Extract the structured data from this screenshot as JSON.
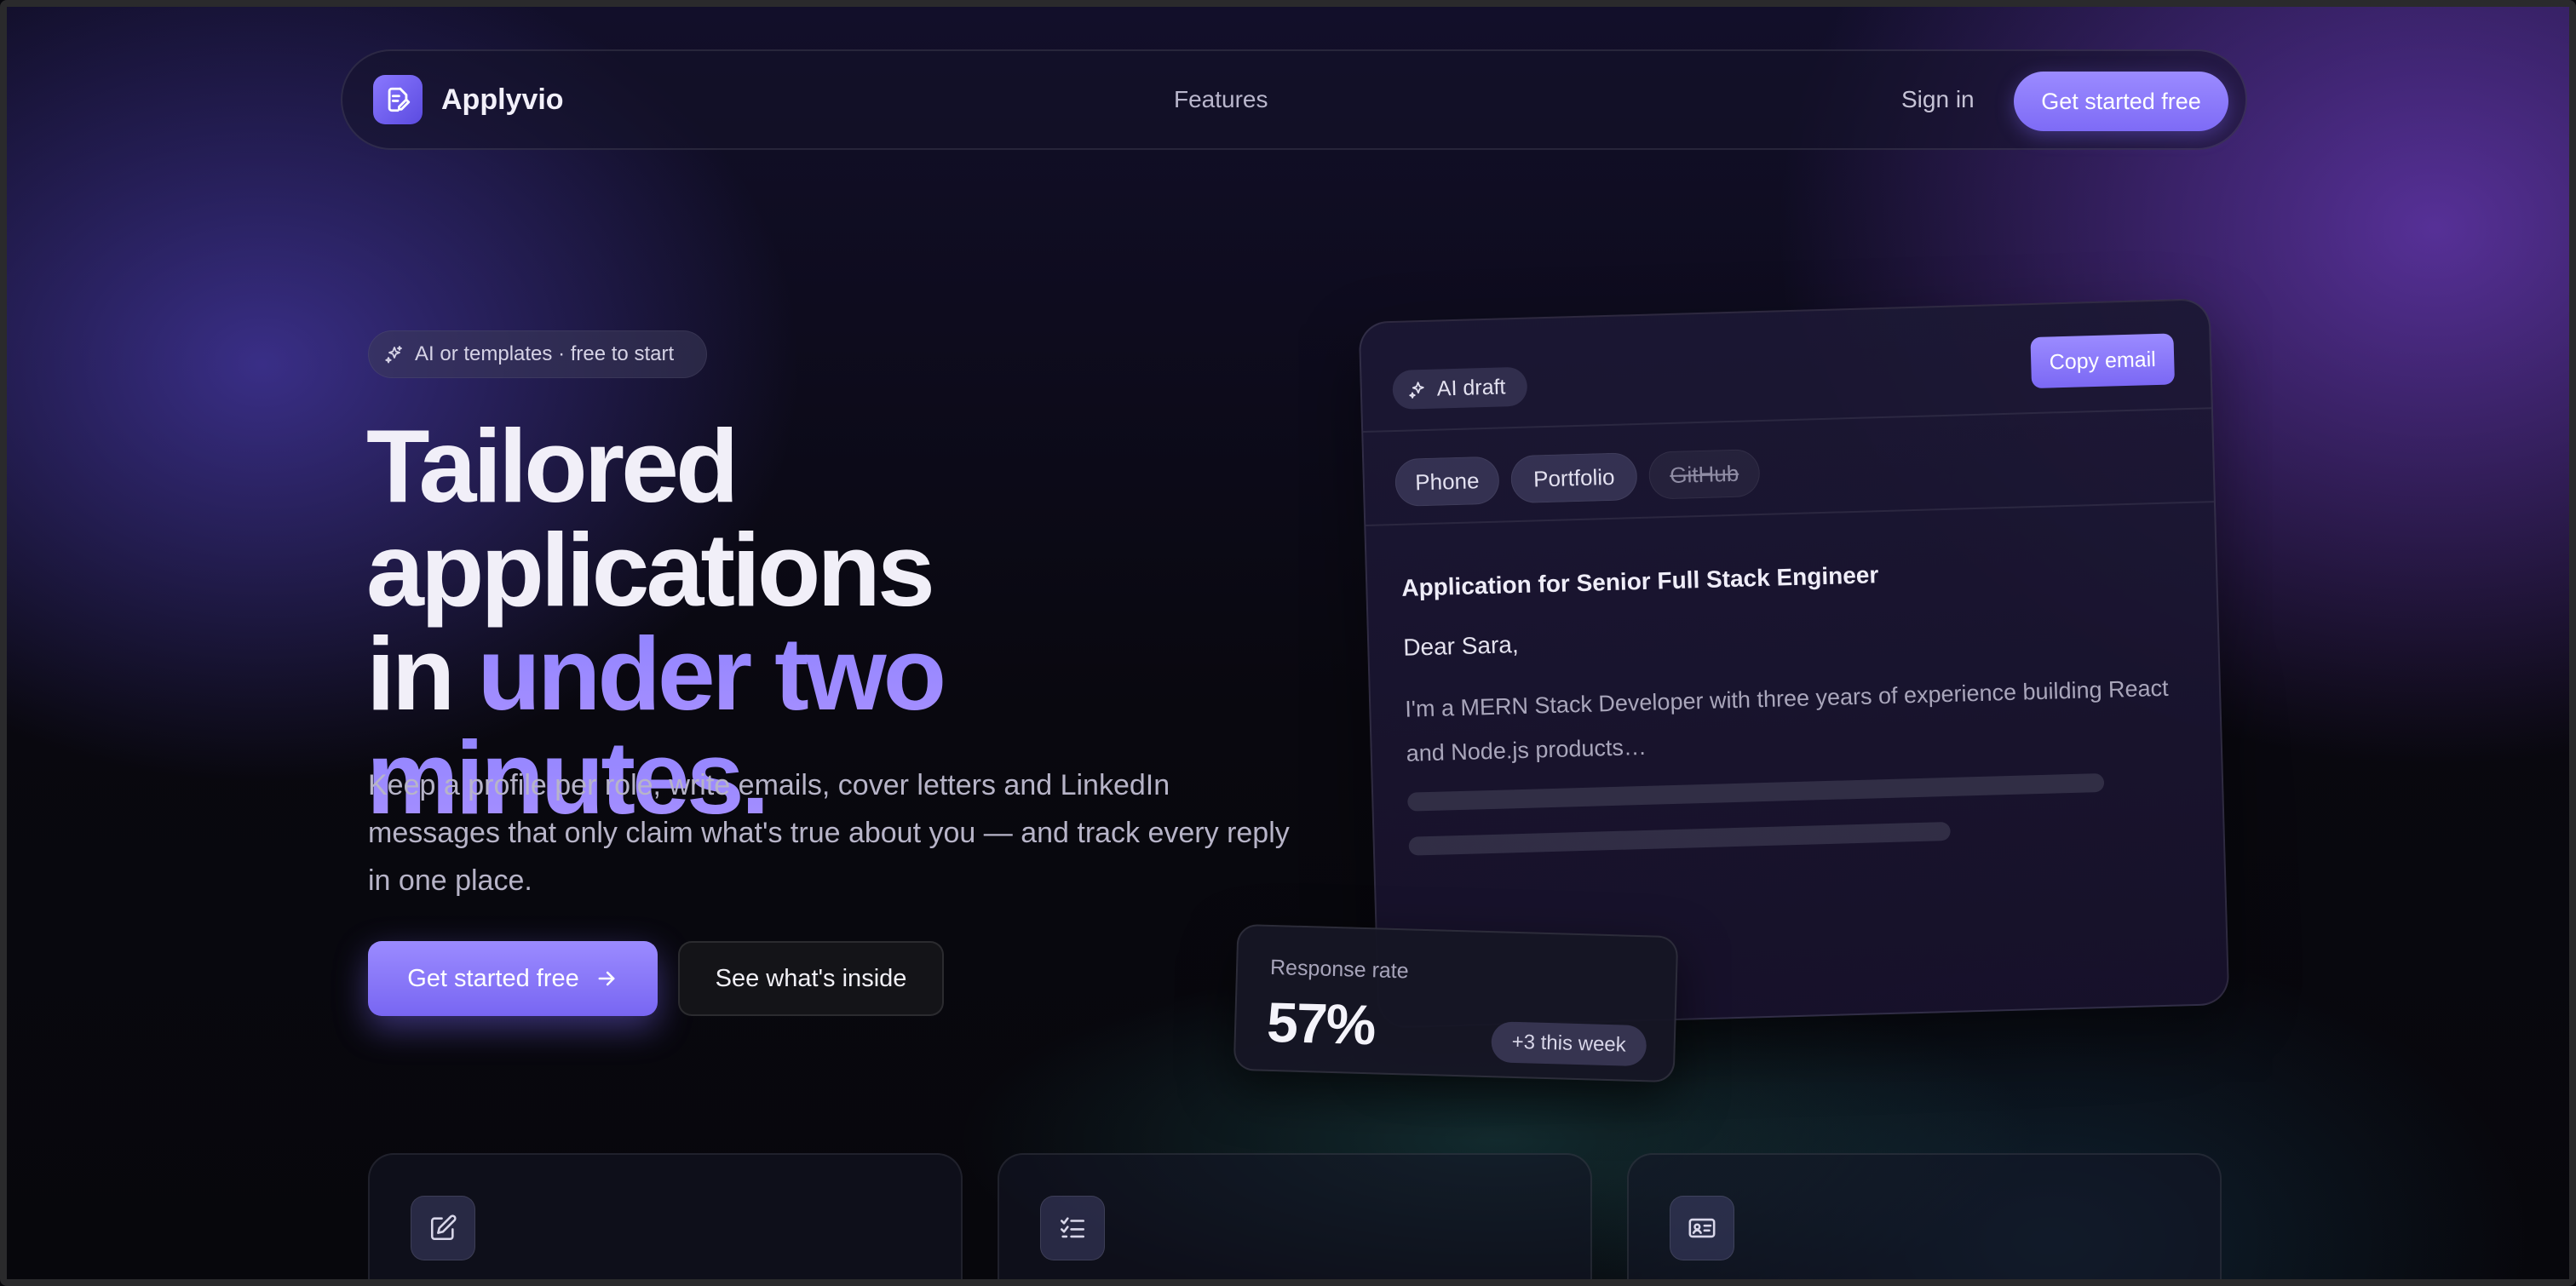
{
  "nav": {
    "brand": "Applyvio",
    "features_link": "Features",
    "sign_in": "Sign in",
    "cta": "Get started free"
  },
  "hero": {
    "pill": "AI or templates · free to start",
    "headline_part1": "Tailored applications",
    "headline_part2": "in",
    "headline_accent": "under two minutes.",
    "subtitle": "Keep a profile per role, write emails, cover letters and LinkedIn messages that only claim what's true about you — and track every reply in one place.",
    "primary_cta": "Get started free",
    "secondary_cta": "See what's inside"
  },
  "draft_card": {
    "ai_chip": "AI draft",
    "copy_button": "Copy email",
    "tags": [
      {
        "label": "Phone",
        "enabled": true
      },
      {
        "label": "Portfolio",
        "enabled": true
      },
      {
        "label": "GitHub",
        "enabled": false
      }
    ],
    "subject": "Application for Senior Full Stack Engineer",
    "greeting": "Dear Sara,",
    "body": "I'm a MERN Stack Developer with three years of experience building React and Node.js products…"
  },
  "response_card": {
    "label": "Response rate",
    "value": "57%",
    "badge": "+3 this week"
  },
  "feature_cards": [
    {
      "icon": "edit-icon"
    },
    {
      "icon": "checklist-icon"
    },
    {
      "icon": "id-card-icon"
    }
  ],
  "colors": {
    "accent": "#8f7dff",
    "accent_dark": "#7866f2",
    "background": "#07070c",
    "text": "#f1eff8",
    "muted_text": "#b7b4c8"
  }
}
